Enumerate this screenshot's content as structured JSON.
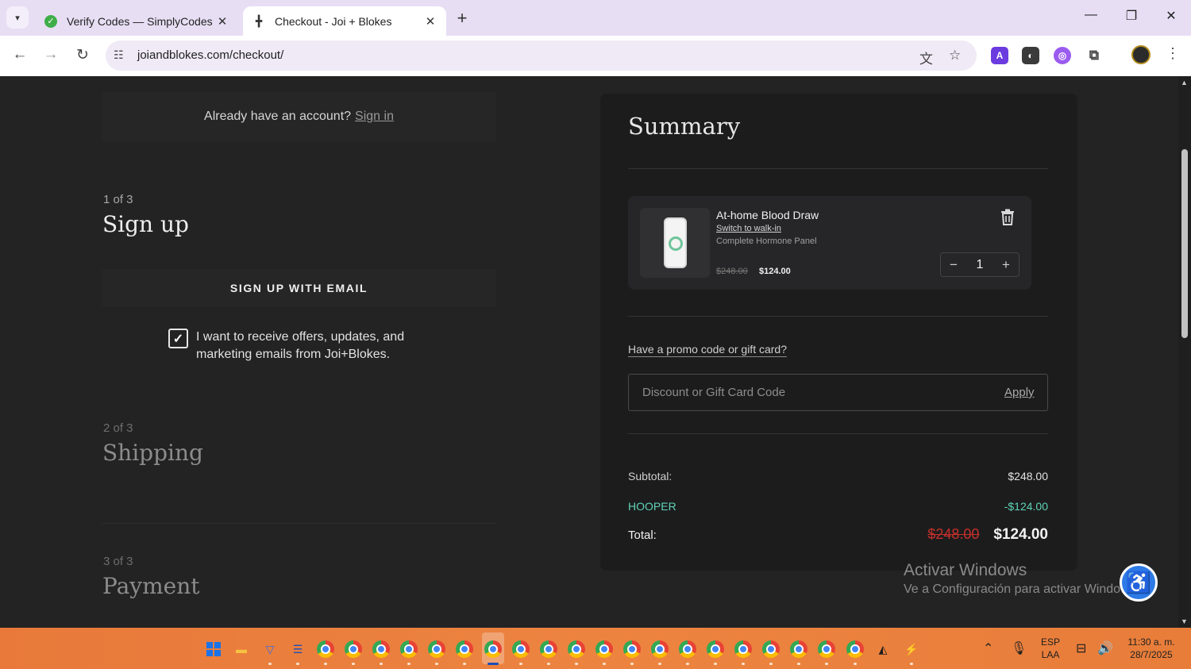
{
  "browser": {
    "tabs": [
      {
        "title": "Verify Codes — SimplyCodes",
        "favicon": "simplycodes-icon"
      },
      {
        "title": "Checkout - Joi + Blokes",
        "favicon": "joiblokes-icon"
      }
    ],
    "url": "joiandblokes.com/checkout/",
    "new_tab": "+",
    "window_controls": {
      "minimize": "—",
      "restore": "❐",
      "close": "✕"
    }
  },
  "left": {
    "account_prompt": "Already have an account?",
    "sign_in": "Sign in",
    "steps": [
      {
        "num": "1 of 3",
        "title": "Sign up"
      },
      {
        "num": "2 of 3",
        "title": "Shipping"
      },
      {
        "num": "3 of 3",
        "title": "Payment"
      }
    ],
    "signup_button": "SIGN UP WITH EMAIL",
    "consent_checked": true,
    "consent_text": "I want to receive offers, updates, and marketing emails from Joi+Blokes."
  },
  "summary": {
    "title": "Summary",
    "item": {
      "name": "At-home Blood Draw",
      "switch_link": "Switch to walk-in",
      "variant": "Complete Hormone Panel",
      "price_old": "$248.00",
      "price_new": "$124.00",
      "qty": "1",
      "minus": "−",
      "plus": "+"
    },
    "promo_link": "Have a promo code or gift card?",
    "promo_placeholder": "Discount or Gift Card Code",
    "apply": "Apply",
    "subtotal_label": "Subtotal:",
    "subtotal_value": "$248.00",
    "code_name": "HOOPER",
    "code_value": "-$124.00",
    "total_label": "Total:",
    "total_old": "$248.00",
    "total_new": "$124.00"
  },
  "watermark": {
    "line1": "Activar Windows",
    "line2": "Ve a Configuración para activar Windows."
  },
  "taskbar": {
    "lang1": "ESP",
    "lang2": "LAA",
    "time": "11:30 a. m.",
    "date": "28/7/2025"
  },
  "colors": {
    "page_bg": "#232324",
    "summary_bg": "#1c1c1d",
    "discount_accent": "#5fd3b6",
    "strike_red": "#c4302b",
    "taskbar": "#ec8440"
  }
}
